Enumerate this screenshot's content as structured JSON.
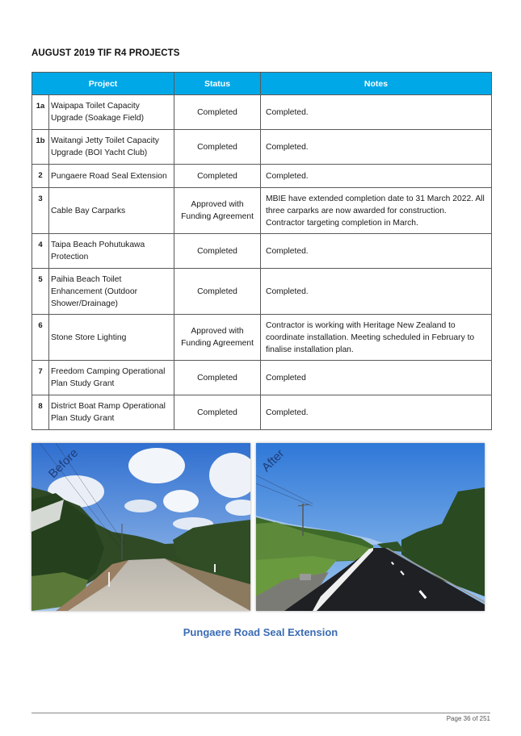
{
  "heading": "AUGUST 2019 TIF R4 PROJECTS",
  "table": {
    "headers": {
      "project": "Project",
      "status": "Status",
      "notes": "Notes"
    },
    "header_color": "#00a8e8",
    "rows": [
      {
        "num": "1a",
        "project": "Waipapa Toilet Capacity Upgrade (Soakage Field)",
        "status": "Completed",
        "notes": "Completed."
      },
      {
        "num": "1b",
        "project": "Waitangi Jetty Toilet Capacity Upgrade (BOI Yacht Club)",
        "status": "Completed",
        "notes": "Completed."
      },
      {
        "num": "2",
        "project": "Pungaere Road Seal Extension",
        "status": "Completed",
        "notes": "Completed."
      },
      {
        "num": "3",
        "project": "Cable Bay Carparks",
        "status": "Approved with Funding Agreement",
        "notes": "MBIE have extended completion date to 31 March 2022. All three carparks are now awarded for construction. Contractor targeting completion in March."
      },
      {
        "num": "4",
        "project": "Taipa Beach Pohutukawa Protection",
        "status": "Completed",
        "notes": "Completed."
      },
      {
        "num": "5",
        "project": "Paihia Beach Toilet Enhancement (Outdoor Shower/Drainage)",
        "status": "Completed",
        "notes": "Completed."
      },
      {
        "num": "6",
        "project": "Stone Store Lighting",
        "status": "Approved with Funding Agreement",
        "notes": "Contractor is working with Heritage New Zealand to coordinate installation.  Meeting scheduled in February to finalise installation plan."
      },
      {
        "num": "7",
        "project": "Freedom Camping Operational Plan Study Grant",
        "status": "Completed",
        "notes": "Completed"
      },
      {
        "num": "8",
        "project": "District Boat Ramp Operational Plan Study Grant",
        "status": "Completed",
        "notes": "Completed."
      }
    ]
  },
  "photos": {
    "before_label": "Before",
    "after_label": "After"
  },
  "caption": "Pungaere Road Seal Extension",
  "caption_color": "#3b6cb4",
  "footer": {
    "page": "Page 36 of 251"
  }
}
